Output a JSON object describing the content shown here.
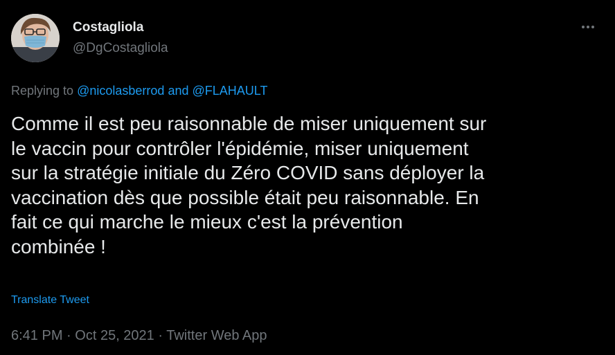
{
  "author": {
    "display_name": "Costagliola",
    "handle": "@DgCostagliola"
  },
  "reply": {
    "prefix": "Replying to",
    "mention_1": "@nicolasberrod",
    "conjunction": "and",
    "mention_2": "@FLAHAULT"
  },
  "tweet": {
    "text": "Comme il est peu raisonnable de miser uniquement sur\nle vaccin pour contrôler l'épidémie, miser uniquement\nsur la stratégie initiale du Zéro COVID sans déployer la\nvaccination dès que possible était peu raisonnable. En\nfait ce qui marche le mieux c'est la prévention\ncombinée !",
    "translate_label": "Translate Tweet"
  },
  "meta": {
    "time": "6:41 PM",
    "separator": "·",
    "date": "Oct 25, 2021",
    "source": "Twitter Web App"
  },
  "icons": {
    "more": "more-horizontal-icon"
  },
  "colors": {
    "background": "#000000",
    "text": "#e7e9ea",
    "muted": "#71767b",
    "link": "#1d9bf0"
  }
}
